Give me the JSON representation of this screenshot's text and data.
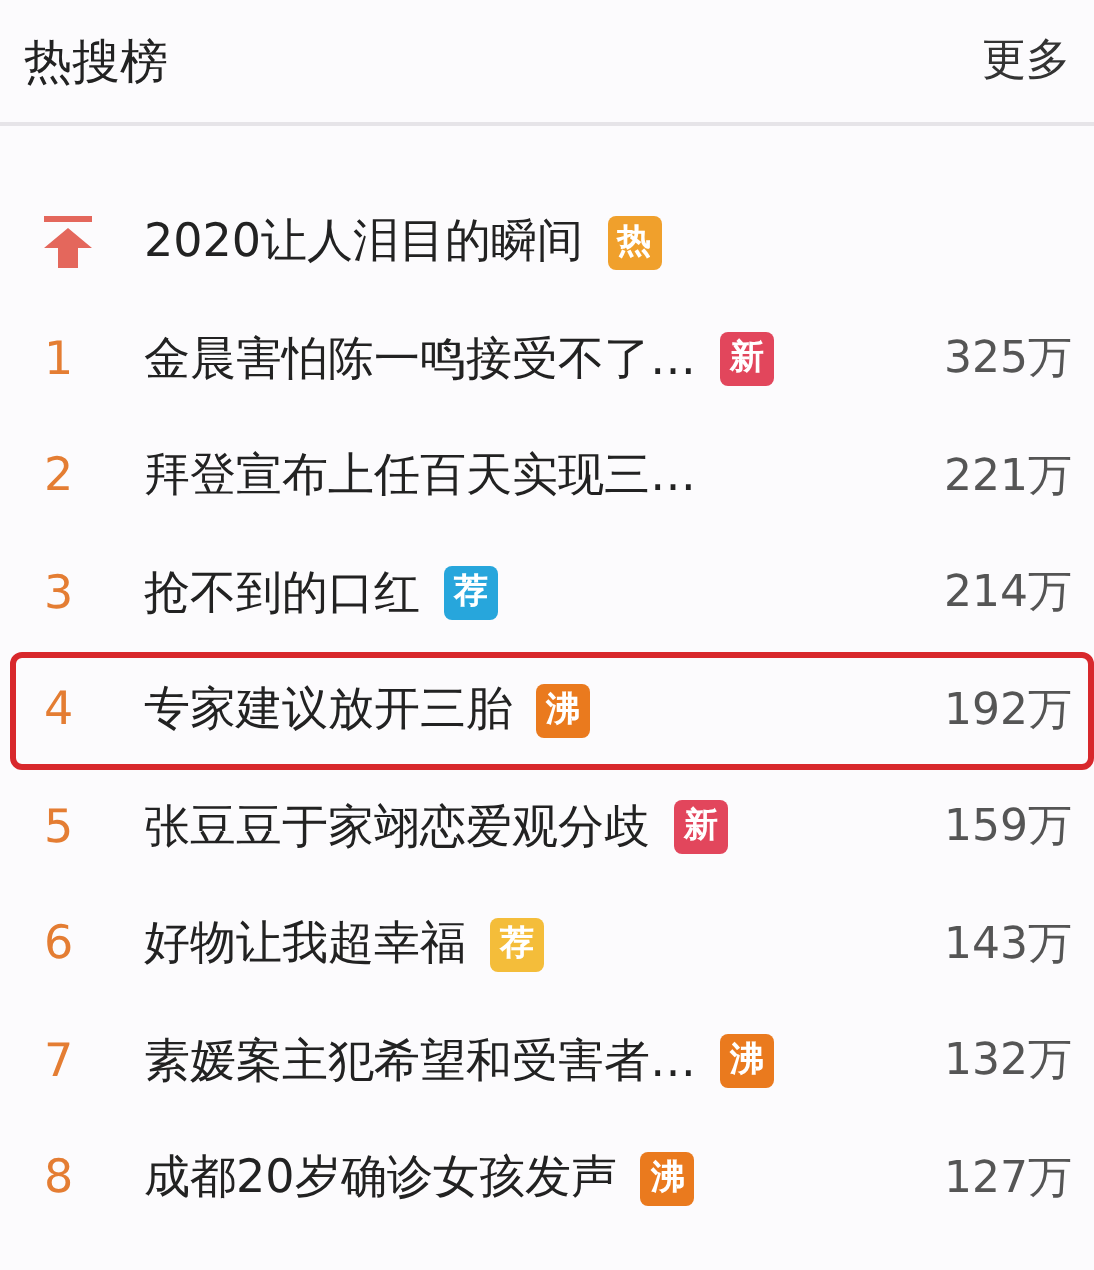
{
  "header": {
    "title": "热搜榜",
    "more": "更多"
  },
  "pinned": {
    "title": "2020让人泪目的瞬间",
    "badge": {
      "text": "热",
      "color": "#f0a02c"
    }
  },
  "items": [
    {
      "rank": "1",
      "title": "金晨害怕陈一鸣接受不了…",
      "badge": {
        "text": "新",
        "color": "#e2465c"
      },
      "count": "325万",
      "highlighted": false
    },
    {
      "rank": "2",
      "title": "拜登宣布上任百天实现三…",
      "count": "221万",
      "highlighted": false
    },
    {
      "rank": "3",
      "title": "抢不到的口红",
      "badge": {
        "text": "荐",
        "color": "#27a6dc"
      },
      "count": "214万",
      "highlighted": false
    },
    {
      "rank": "4",
      "title": "专家建议放开三胎",
      "badge": {
        "text": "沸",
        "color": "#ea7a1e"
      },
      "count": "192万",
      "highlighted": true
    },
    {
      "rank": "5",
      "title": "张豆豆于家翊恋爱观分歧",
      "badge": {
        "text": "新",
        "color": "#e2465c"
      },
      "count": "159万",
      "highlighted": false
    },
    {
      "rank": "6",
      "title": "好物让我超幸福",
      "badge": {
        "text": "荐",
        "color": "#f4bd3a"
      },
      "count": "143万",
      "highlighted": false
    },
    {
      "rank": "7",
      "title": "素媛案主犯希望和受害者…",
      "badge": {
        "text": "沸",
        "color": "#ea7a1e"
      },
      "count": "132万",
      "highlighted": false
    },
    {
      "rank": "8",
      "title": "成都20岁确诊女孩发声",
      "badge": {
        "text": "沸",
        "color": "#ea7a1e"
      },
      "count": "127万",
      "highlighted": false
    }
  ]
}
